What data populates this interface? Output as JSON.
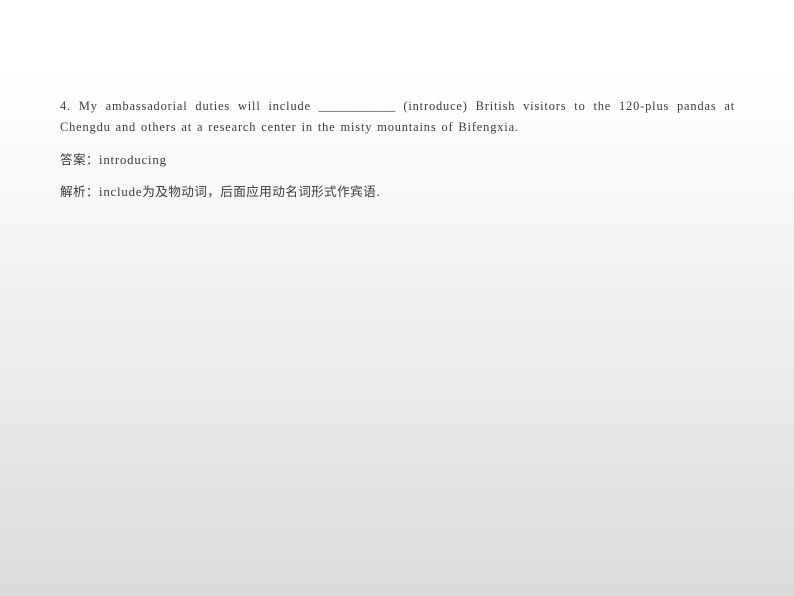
{
  "slide": {
    "background": {
      "top_color": "#ffffff",
      "bottom_color": "#dadada"
    },
    "text_color": "#3b3b3b"
  },
  "exercise": {
    "number": "4.",
    "question_part1": "My ambassadorial duties will include",
    "blank": "____________",
    "question_part2": "(introduce) British visitors to the 120-plus pandas at Chengdu and others at a research center in the misty mountains of Bifengxia.",
    "full_question": "4. My ambassadorial duties will include ____________ (introduce) British visitors to the 120-plus pandas at Chengdu and others at a research center in the misty mountains of Bifengxia."
  },
  "answer": {
    "label": "答案：",
    "value": "introducing"
  },
  "analysis": {
    "label": "解析：",
    "text_latin": "include",
    "text_cjk": "为及物动词，后面应用动名词形式作宾语."
  }
}
